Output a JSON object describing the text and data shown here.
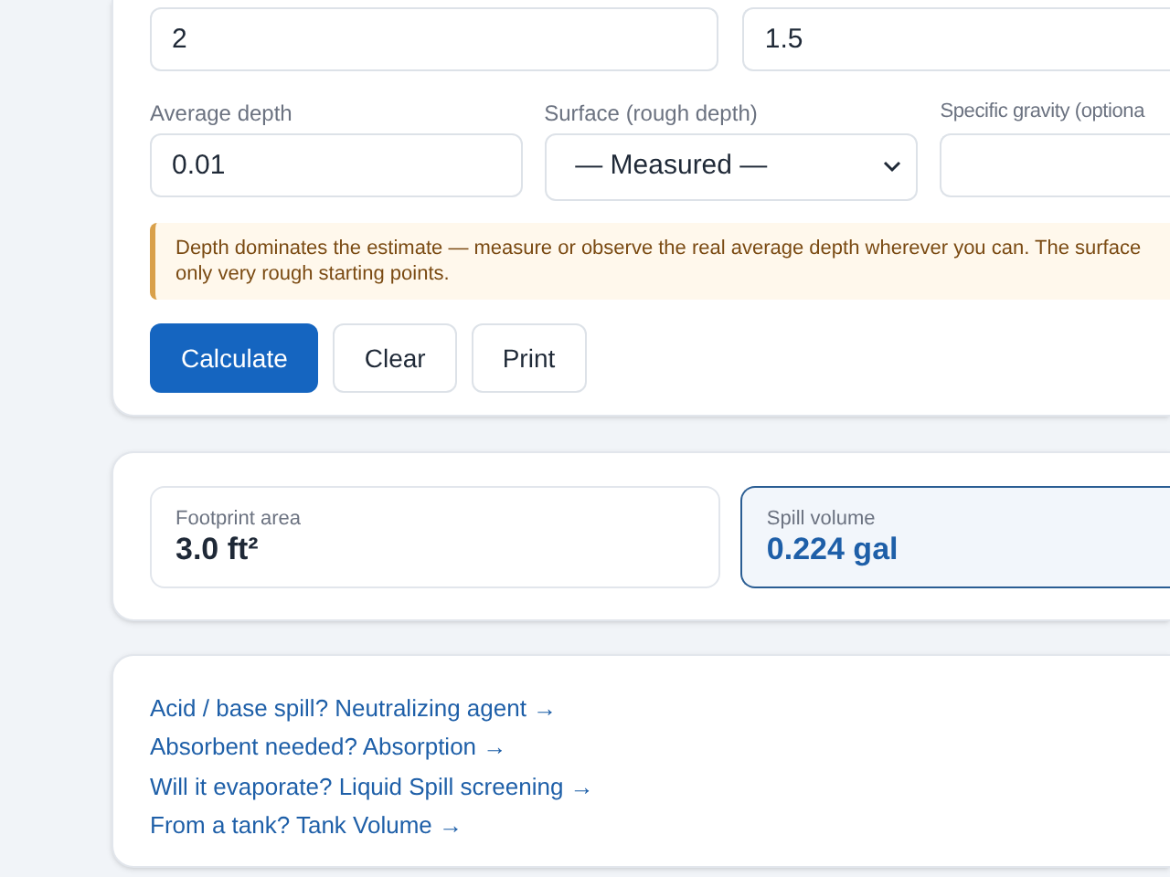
{
  "inputs_top": [
    {
      "value": "2"
    },
    {
      "value": "1.5"
    }
  ],
  "fields": [
    {
      "kind": "input",
      "label": "Average depth",
      "value": "0.01"
    },
    {
      "kind": "select",
      "label": "Surface (rough depth)",
      "value": "— Measured —"
    },
    {
      "kind": "input",
      "label": "Specific gravity (optiona"
    }
  ],
  "notice": {
    "lines": [
      "Depth dominates the estimate — measure or observe the real average depth wherever you can. The surface",
      "only very rough starting points."
    ]
  },
  "buttons": [
    {
      "label": "Calculate",
      "kind": "primary"
    },
    {
      "label": "Clear",
      "kind": "secondary"
    },
    {
      "label": "Print",
      "kind": "secondary"
    }
  ],
  "results": [
    {
      "label": "Footprint area",
      "value": "3.0 ft²",
      "selected": false
    },
    {
      "label": "Spill volume",
      "value": "0.224 gal",
      "selected": true
    }
  ],
  "links": [
    "Acid / base spill? Neutralizing agent →",
    "Absorbent needed? Absorption →",
    "Will it evaporate? Liquid Spill screening →",
    "From a tank? Tank Volume →"
  ]
}
